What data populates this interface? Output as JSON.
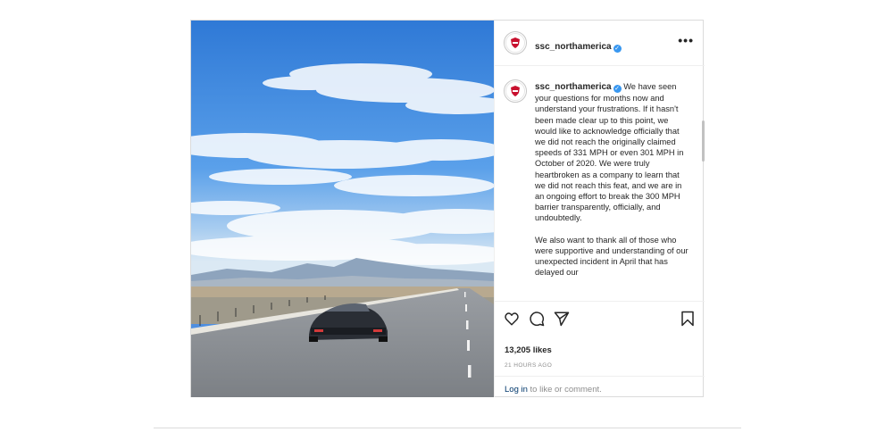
{
  "post": {
    "username": "ssc_northamerica",
    "more_label": "•••",
    "caption_paragraph_1": "We have seen your questions for months now and understand your frustrations. If it hasn't been made clear up to this point, we would like to acknowledge officially that we did not reach the originally claimed speeds of 331 MPH or even 301 MPH in October of 2020. We were truly heartbroken as a company to learn that we did not reach this feat, and we are in an ongoing effort to break the 300 MPH barrier transparently, officially, and undoubtedly.",
    "caption_paragraph_2": "We also want to thank all of those who were supportive and understanding of our unexpected incident in April that has delayed our",
    "likes": "13,205 likes",
    "time_ago": "21 HOURS AGO",
    "login_link": "Log in",
    "login_suffix": " to like or comment."
  },
  "colors": {
    "verified": "#3897f0",
    "link": "#00376b",
    "muted": "#8e8e8e"
  },
  "icons": {
    "like": "heart-icon",
    "comment": "comment-icon",
    "share": "send-icon",
    "save": "bookmark-icon",
    "verified": "verified-badge-icon",
    "avatar": "ssc-logo-avatar"
  }
}
